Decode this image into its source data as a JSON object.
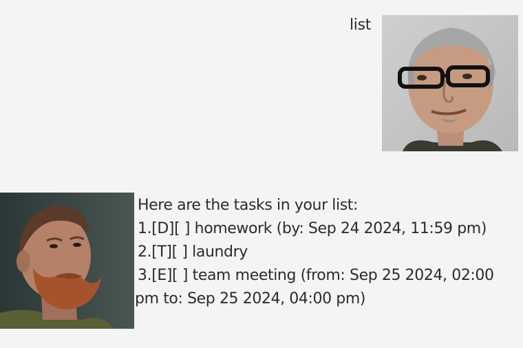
{
  "conversation": {
    "user_message": "list",
    "bot_intro": "Here are the tasks in your list:",
    "tasks": [
      "1.[D][ ] homework (by: Sep 24 2024, 11:59 pm)",
      "2.[T][ ] laundry",
      "3.[E][ ] team meeting (from: Sep 25 2024, 02:00 pm to: Sep 25 2024, 04:00 pm)"
    ]
  },
  "icons": {
    "user_avatar": "user-avatar-photo",
    "bot_avatar": "bot-avatar-photo"
  }
}
